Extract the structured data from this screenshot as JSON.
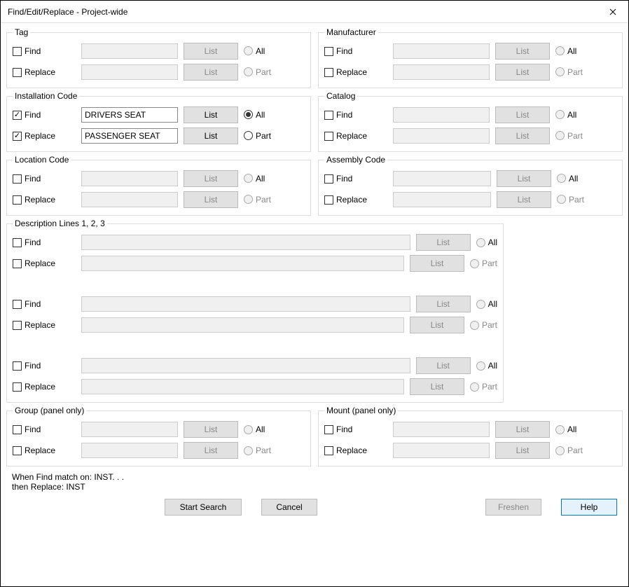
{
  "window": {
    "title": "Find/Edit/Replace - Project-wide"
  },
  "labels": {
    "find": "Find",
    "replace": "Replace",
    "list": "List",
    "all": "All",
    "part": "Part"
  },
  "sections": {
    "tag": {
      "title": "Tag",
      "find_checked": false,
      "replace_checked": false,
      "find_val": "",
      "replace_val": "",
      "scope": "all"
    },
    "manufacturer": {
      "title": "Manufacturer",
      "find_checked": false,
      "replace_checked": false,
      "find_val": "",
      "replace_val": "",
      "scope": "all"
    },
    "installation": {
      "title": "Installation Code",
      "find_checked": true,
      "replace_checked": true,
      "find_val": "DRIVERS SEAT",
      "replace_val": "PASSENGER SEAT",
      "scope": "all"
    },
    "catalog": {
      "title": "Catalog",
      "find_checked": false,
      "replace_checked": false,
      "find_val": "",
      "replace_val": "",
      "scope": "all"
    },
    "location": {
      "title": "Location Code",
      "find_checked": false,
      "replace_checked": false,
      "find_val": "",
      "replace_val": "",
      "scope": "all"
    },
    "assembly": {
      "title": "Assembly Code",
      "find_checked": false,
      "replace_checked": false,
      "find_val": "",
      "replace_val": "",
      "scope": "all"
    },
    "description": {
      "title": "Description Lines 1, 2, 3",
      "line1": {
        "find_checked": false,
        "replace_checked": false,
        "find_val": "",
        "replace_val": "",
        "scope": "all"
      },
      "line2": {
        "find_checked": false,
        "replace_checked": false,
        "find_val": "",
        "replace_val": "",
        "scope": "all"
      },
      "line3": {
        "find_checked": false,
        "replace_checked": false,
        "find_val": "",
        "replace_val": "",
        "scope": "all"
      }
    },
    "group": {
      "title": "Group (panel only)",
      "find_checked": false,
      "replace_checked": false,
      "find_val": "",
      "replace_val": "",
      "scope": "all"
    },
    "mount": {
      "title": "Mount (panel only)",
      "find_checked": false,
      "replace_checked": false,
      "find_val": "",
      "replace_val": "",
      "scope": "all"
    }
  },
  "footer": {
    "line1": "When Find match on:  INST. . .",
    "line2": "then Replace:  INST"
  },
  "buttons": {
    "start_search": "Start Search",
    "cancel": "Cancel",
    "freshen": "Freshen",
    "help": "Help"
  }
}
